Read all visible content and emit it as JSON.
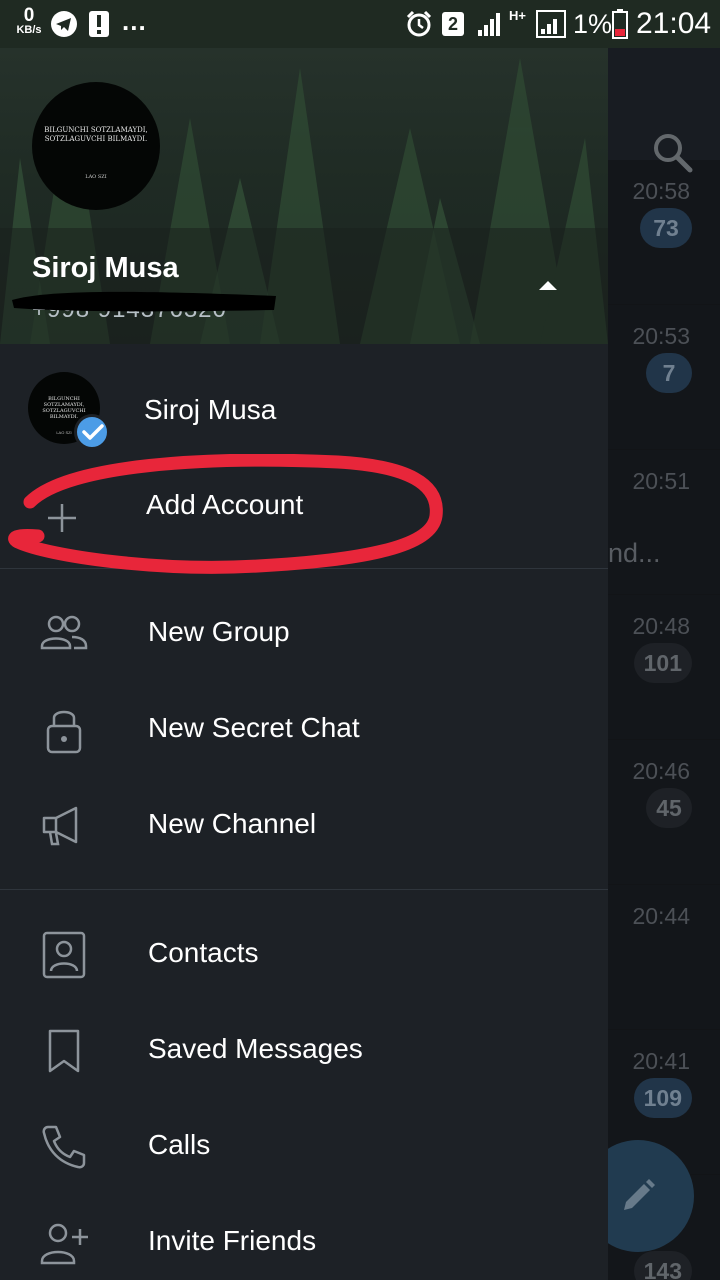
{
  "status_bar": {
    "speed_value": "0",
    "speed_unit": "KB/s",
    "overflow": "...",
    "sim_number": "2",
    "network_type": "H+",
    "battery": "1%",
    "time": "21:04"
  },
  "drawer": {
    "header": {
      "name": "Siroj Musa",
      "phone": "+998 914376320",
      "avatar_text": "BILGUNCHI SOTZLAMAYDI, SOTZLAGUVCHI BILMAYDI.",
      "avatar_subtext": "LAO SZI"
    },
    "accounts": [
      {
        "name": "Siroj Musa",
        "verified": true
      }
    ],
    "add_account_label": "Add Account",
    "menu_group_1": [
      {
        "label": "New Group",
        "icon": "group-icon"
      },
      {
        "label": "New Secret Chat",
        "icon": "lock-icon"
      },
      {
        "label": "New Channel",
        "icon": "megaphone-icon"
      }
    ],
    "menu_group_2": [
      {
        "label": "Contacts",
        "icon": "contact-card-icon"
      },
      {
        "label": "Saved Messages",
        "icon": "bookmark-icon"
      },
      {
        "label": "Calls",
        "icon": "phone-icon"
      },
      {
        "label": "Invite Friends",
        "icon": "add-person-icon"
      }
    ]
  },
  "chat_list": {
    "rows": [
      {
        "time": "20:58",
        "badge": "73",
        "snippet": ""
      },
      {
        "time": "20:53",
        "badge": "7",
        "snippet": ""
      },
      {
        "time": "20:51",
        "badge": "",
        "snippet": "nd..."
      },
      {
        "time": "20:48",
        "badge": "101",
        "snippet": ""
      },
      {
        "time": "20:46",
        "badge": "45",
        "snippet": ""
      },
      {
        "time": "20:44",
        "badge": "",
        "snippet": ""
      },
      {
        "time": "20:41",
        "badge": "109",
        "snippet": ""
      },
      {
        "time": "",
        "badge": "143",
        "snippet": ""
      }
    ]
  },
  "colors": {
    "drawer_bg": "#1d2126",
    "accent_blue": "#4c9ce6",
    "annotation_red": "#e8263a"
  }
}
